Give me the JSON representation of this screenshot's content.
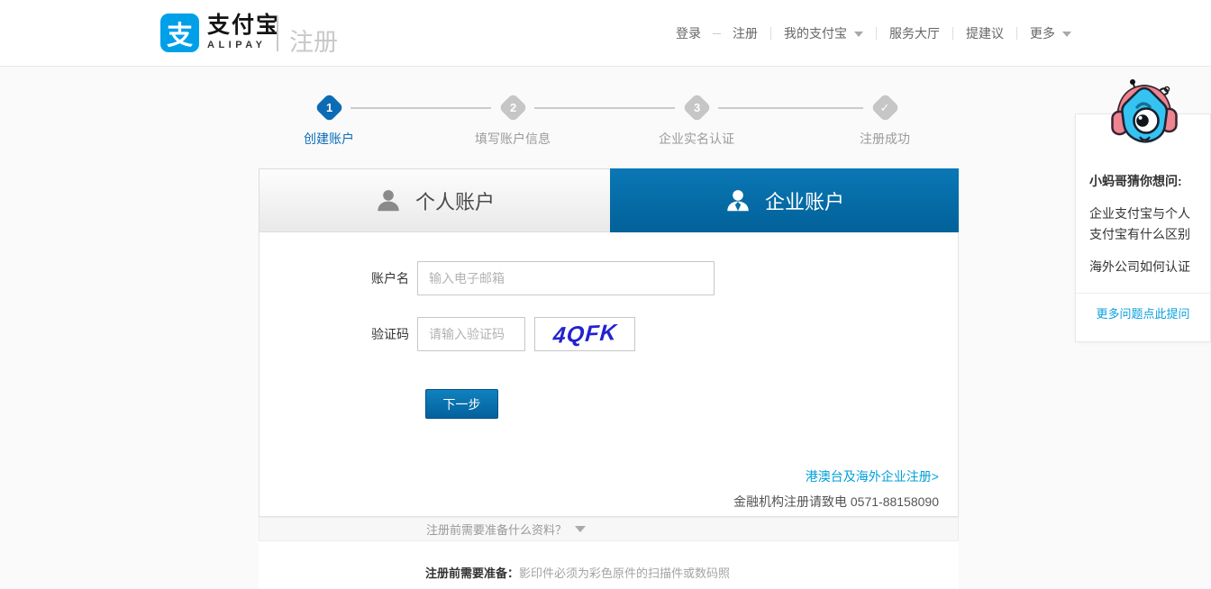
{
  "header": {
    "logo": {
      "mark_glyph": "支",
      "brand_cn": "支付宝",
      "brand_en": "ALIPAY",
      "page_label": "注册"
    },
    "nav": {
      "login": "登录",
      "register": "注册",
      "my_alipay": "我的支付宝",
      "service_hall": "服务大厅",
      "feedback": "提建议",
      "more": "更多"
    }
  },
  "steps": [
    {
      "num": "1",
      "label": "创建账户",
      "state": "active"
    },
    {
      "num": "2",
      "label": "填写账户信息",
      "state": "pending"
    },
    {
      "num": "3",
      "label": "企业实名认证",
      "state": "pending"
    },
    {
      "num": "✓",
      "label": "注册成功",
      "state": "pending"
    }
  ],
  "tabs": {
    "personal": "个人账户",
    "enterprise": "企业账户",
    "selected": "企业账户"
  },
  "form": {
    "account_label": "账户名",
    "account_placeholder": "输入电子邮箱",
    "account_value": "",
    "captcha_label": "验证码",
    "captcha_placeholder": "请输入验证码",
    "captcha_value": "",
    "captcha_image_text": "4QFK",
    "next_button": "下一步"
  },
  "links": {
    "overseas": "港澳台及海外企业注册>",
    "finance_note": "金融机构注册请致电 0571-88158090"
  },
  "prep": {
    "bar_label": "注册前需要准备什么资料？",
    "note_title": "注册前需要准备：",
    "note_text": "影印件必须为彩色原件的扫描件或数码照"
  },
  "help": {
    "mascot": "robot-mascot",
    "title": "小蚂哥猜你想问:",
    "questions": [
      "企业支付宝与个人支付宝有什么区别",
      "海外公司如何认证"
    ],
    "more_link": "更多问题点此提问"
  },
  "colors": {
    "brand_blue": "#00a0e9",
    "tab_blue": "#0269ab",
    "step_active_blue": "#0b6cb5",
    "link_blue": "#00a0d8",
    "captcha_blue": "#2222cf",
    "page_bg": "#fafafa"
  }
}
